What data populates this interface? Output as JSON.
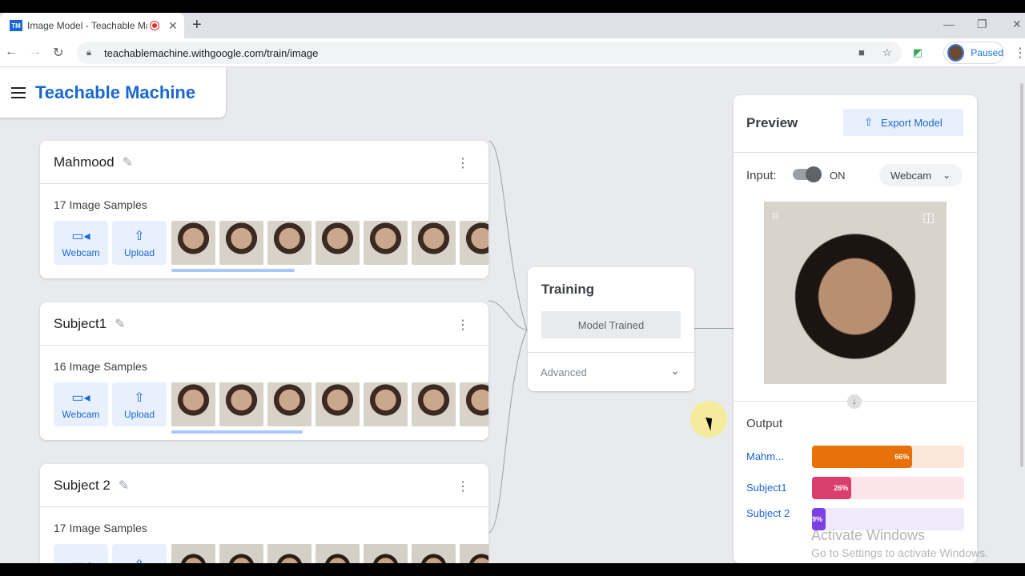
{
  "browser": {
    "tab_title": "Image Model - Teachable Machine",
    "favicon_text": "TM",
    "url": "teachablemachine.withgoogle.com/train/image",
    "profile_status": "Paused"
  },
  "app": {
    "title": "Teachable Machine"
  },
  "classes": [
    {
      "name": "Mahmood",
      "samples": "17 Image Samples",
      "webcam_label": "Webcam",
      "upload_label": "Upload"
    },
    {
      "name": "Subject1",
      "samples": "16 Image Samples",
      "webcam_label": "Webcam",
      "upload_label": "Upload"
    },
    {
      "name": "Subject 2",
      "samples": "17 Image Samples",
      "webcam_label": "",
      "upload_label": ""
    }
  ],
  "training": {
    "title": "Training",
    "button_label": "Model Trained",
    "advanced_label": "Advanced"
  },
  "preview": {
    "title": "Preview",
    "export_label": "Export Model",
    "input_label": "Input:",
    "toggle_state": "ON",
    "source_select": "Webcam",
    "output_label": "Output",
    "outputs": [
      {
        "name": "Mahm...",
        "percent_label": "66%",
        "fraction": 0.66,
        "color": "#e8710a",
        "track": "#fde7da"
      },
      {
        "name": "Subject1",
        "percent_label": "26%",
        "fraction": 0.26,
        "color": "#d93f6b",
        "track": "#fce4ea"
      },
      {
        "name": "Subject 2",
        "percent_label": "9%",
        "fraction": 0.09,
        "color": "#7b3fe4",
        "track": "#efe9fc"
      }
    ]
  },
  "watermark": {
    "line1": "Activate Windows",
    "line2": "Go to Settings to activate Windows."
  },
  "icons": {
    "webcam": "videocam-icon",
    "upload": "upload-icon",
    "edit": "pencil-icon",
    "more": "more-vert-icon",
    "export": "upload-icon",
    "chevron": "chevron-down-icon"
  }
}
